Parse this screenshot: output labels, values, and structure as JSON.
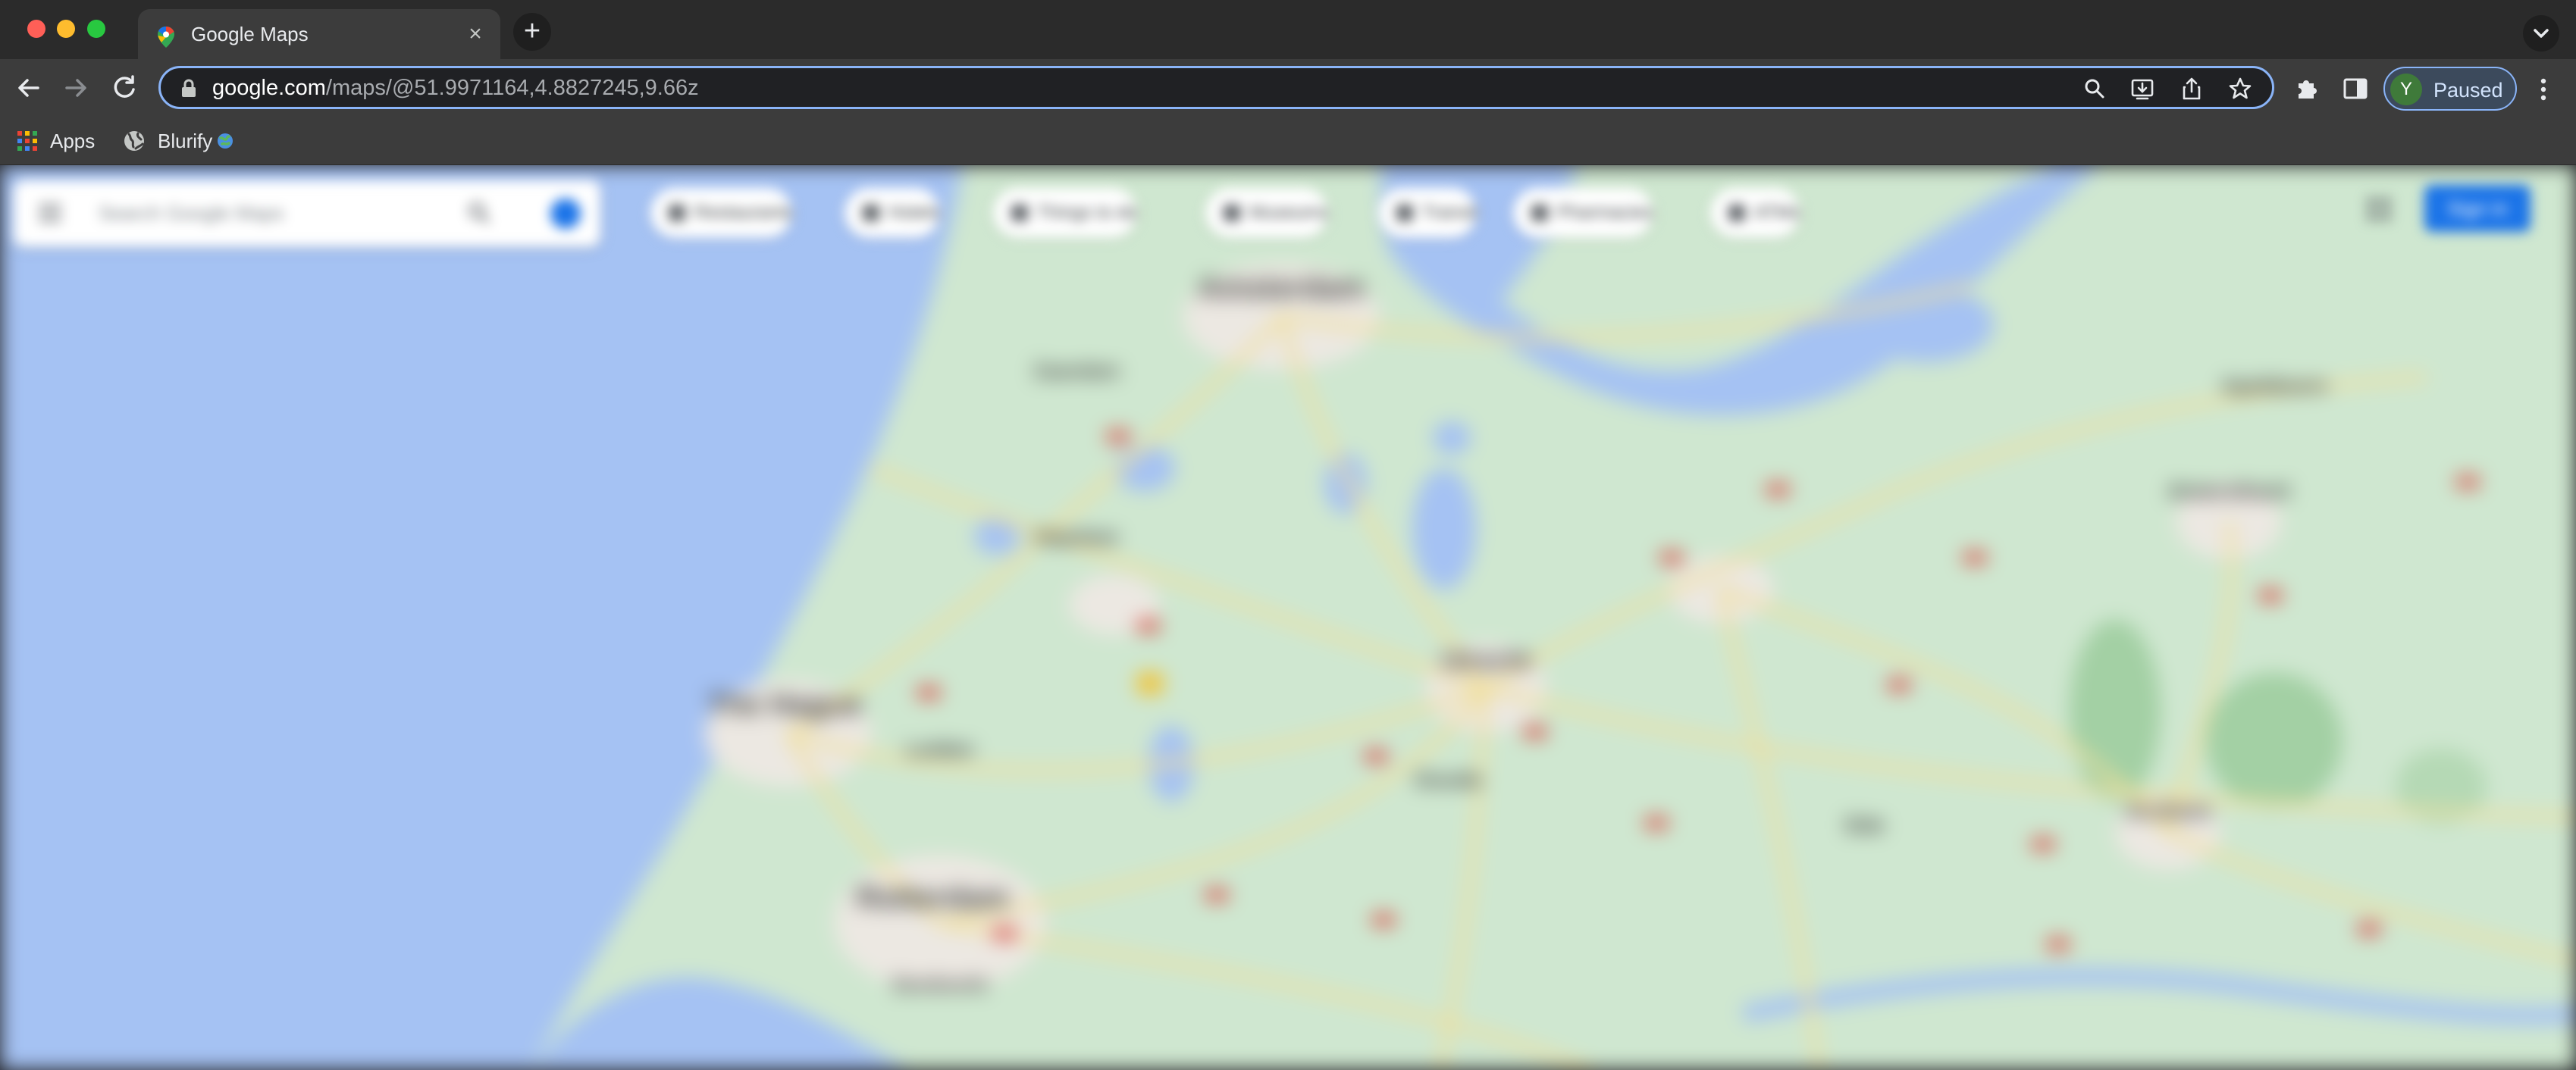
{
  "browser": {
    "tab": {
      "title": "Google Maps",
      "favicon": "google-maps-pin-icon",
      "close_icon": "close-icon"
    },
    "new_tab_icon": "plus-icon",
    "tab_search_icon": "chevron-down-icon",
    "toolbar": {
      "back_icon": "arrow-left-icon",
      "forward_icon": "arrow-right-icon",
      "reload_icon": "reload-icon",
      "url_host": "google.com",
      "url_path": "/maps/@51.9971164,4.8827245,9.66z",
      "omnibox_icons": [
        "search-icon",
        "install-icon",
        "share-icon",
        "star-icon"
      ],
      "extensions_icon": "puzzle-icon",
      "side_panel_icon": "side-panel-icon",
      "profile": {
        "initial": "Y",
        "label": "Paused"
      },
      "menu_icon": "kebab-menu-icon"
    },
    "bookmarks": [
      {
        "label": "Apps",
        "icon": "apps-grid-icon"
      },
      {
        "label": "Blurify",
        "icon": "globe-icon",
        "suffix_icon": "earth-emoji-icon"
      }
    ]
  },
  "map": {
    "blurred": true,
    "search": {
      "placeholder": "Search Google Maps"
    },
    "chips": [
      "Restaurants",
      "Hotels",
      "Things to do",
      "Museums",
      "Transit",
      "Pharmacies",
      "ATMs"
    ],
    "sign_in_label": "Sign in",
    "places": [
      "Amsterdam",
      "Utrecht",
      "The Hague",
      "Rotterdam",
      "Leiden",
      "Haarlem",
      "Amersfoort",
      "Gouda",
      "Apeldoorn",
      "Arnhem",
      "Dordrecht",
      "Zaandam",
      "Ede"
    ],
    "colors": {
      "water": "#a5c2f3",
      "land": "#cfe7d0",
      "roads": "#f1df9b",
      "city": "#ece8e2",
      "highway_shield": "#d9544d",
      "brand_blue": "#1a73e8"
    }
  }
}
